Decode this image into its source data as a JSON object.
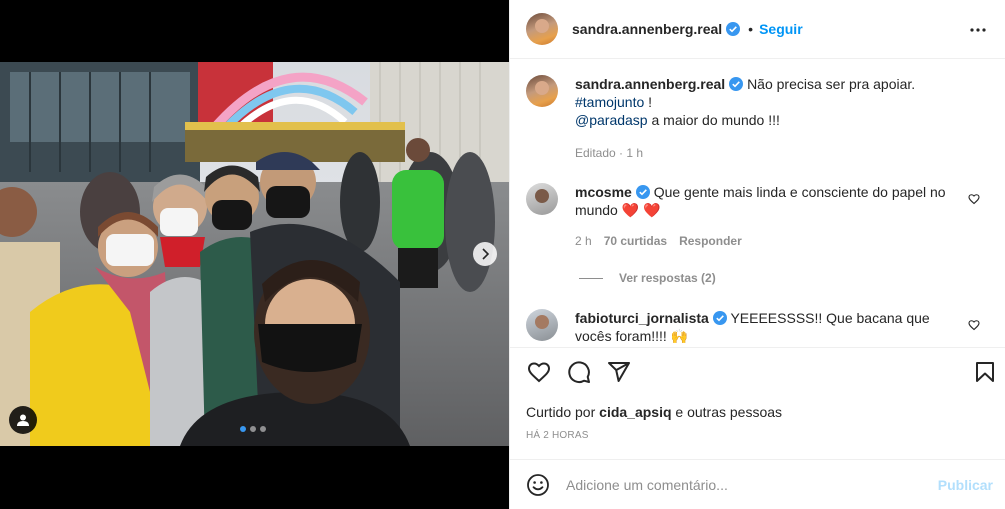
{
  "post": {
    "author": "sandra.annenberg.real",
    "follow_label": "Seguir",
    "separator": "•",
    "caption_text": "Não precisa ser pra apoiar.",
    "caption_hashtag": "#tamojunto",
    "caption_hashtag_suffix": " !",
    "caption_mention": "@paradasp",
    "caption_mention_suffix": " a maior do mundo !!!",
    "caption_meta": "Editado · 1 h",
    "carousel_position": 1,
    "carousel_total": 3
  },
  "comments": [
    {
      "user": "mcosme",
      "verified": true,
      "text": "Que gente mais linda e consciente do papel no mundo ❤️ ❤️",
      "time": "2 h",
      "likes": "70 curtidas",
      "reply": "Responder"
    },
    {
      "user": "fabioturci_jornalista",
      "verified": true,
      "text": "YEEEESSSS!! Que bacana que vocês foram!!!! 🙌"
    }
  ],
  "view_replies": "Ver respostas (2)",
  "likes": {
    "prefix": "Curtido por ",
    "user": "cida_apsiq",
    "suffix": " e outras pessoas"
  },
  "timestamp": "HÁ 2 HORAS",
  "composer": {
    "placeholder": "Adicione um comentário...",
    "publish_label": "Publicar"
  },
  "colors": {
    "link": "#0095f6",
    "tag": "#00376b",
    "secondary_text": "#8e8e8e",
    "heart": "#ed4956"
  }
}
